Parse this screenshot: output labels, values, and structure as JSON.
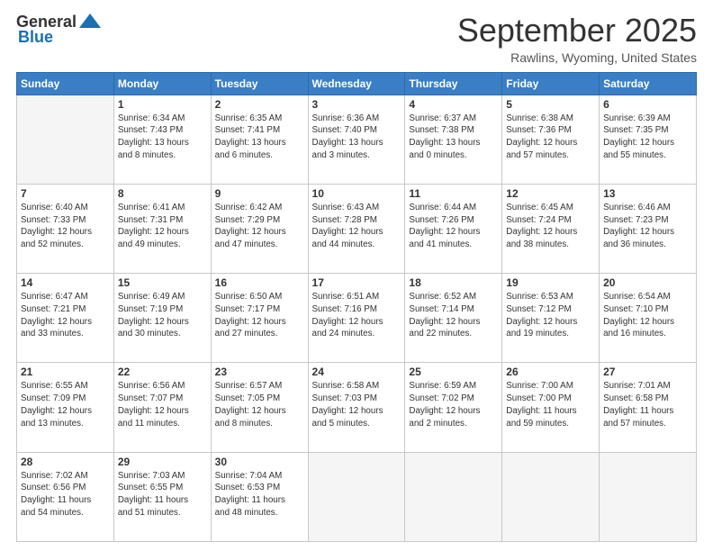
{
  "logo": {
    "general": "General",
    "blue": "Blue"
  },
  "header": {
    "month": "September 2025",
    "location": "Rawlins, Wyoming, United States"
  },
  "weekdays": [
    "Sunday",
    "Monday",
    "Tuesday",
    "Wednesday",
    "Thursday",
    "Friday",
    "Saturday"
  ],
  "weeks": [
    [
      {
        "day": "",
        "info": ""
      },
      {
        "day": "1",
        "info": "Sunrise: 6:34 AM\nSunset: 7:43 PM\nDaylight: 13 hours\nand 8 minutes."
      },
      {
        "day": "2",
        "info": "Sunrise: 6:35 AM\nSunset: 7:41 PM\nDaylight: 13 hours\nand 6 minutes."
      },
      {
        "day": "3",
        "info": "Sunrise: 6:36 AM\nSunset: 7:40 PM\nDaylight: 13 hours\nand 3 minutes."
      },
      {
        "day": "4",
        "info": "Sunrise: 6:37 AM\nSunset: 7:38 PM\nDaylight: 13 hours\nand 0 minutes."
      },
      {
        "day": "5",
        "info": "Sunrise: 6:38 AM\nSunset: 7:36 PM\nDaylight: 12 hours\nand 57 minutes."
      },
      {
        "day": "6",
        "info": "Sunrise: 6:39 AM\nSunset: 7:35 PM\nDaylight: 12 hours\nand 55 minutes."
      }
    ],
    [
      {
        "day": "7",
        "info": "Sunrise: 6:40 AM\nSunset: 7:33 PM\nDaylight: 12 hours\nand 52 minutes."
      },
      {
        "day": "8",
        "info": "Sunrise: 6:41 AM\nSunset: 7:31 PM\nDaylight: 12 hours\nand 49 minutes."
      },
      {
        "day": "9",
        "info": "Sunrise: 6:42 AM\nSunset: 7:29 PM\nDaylight: 12 hours\nand 47 minutes."
      },
      {
        "day": "10",
        "info": "Sunrise: 6:43 AM\nSunset: 7:28 PM\nDaylight: 12 hours\nand 44 minutes."
      },
      {
        "day": "11",
        "info": "Sunrise: 6:44 AM\nSunset: 7:26 PM\nDaylight: 12 hours\nand 41 minutes."
      },
      {
        "day": "12",
        "info": "Sunrise: 6:45 AM\nSunset: 7:24 PM\nDaylight: 12 hours\nand 38 minutes."
      },
      {
        "day": "13",
        "info": "Sunrise: 6:46 AM\nSunset: 7:23 PM\nDaylight: 12 hours\nand 36 minutes."
      }
    ],
    [
      {
        "day": "14",
        "info": "Sunrise: 6:47 AM\nSunset: 7:21 PM\nDaylight: 12 hours\nand 33 minutes."
      },
      {
        "day": "15",
        "info": "Sunrise: 6:49 AM\nSunset: 7:19 PM\nDaylight: 12 hours\nand 30 minutes."
      },
      {
        "day": "16",
        "info": "Sunrise: 6:50 AM\nSunset: 7:17 PM\nDaylight: 12 hours\nand 27 minutes."
      },
      {
        "day": "17",
        "info": "Sunrise: 6:51 AM\nSunset: 7:16 PM\nDaylight: 12 hours\nand 24 minutes."
      },
      {
        "day": "18",
        "info": "Sunrise: 6:52 AM\nSunset: 7:14 PM\nDaylight: 12 hours\nand 22 minutes."
      },
      {
        "day": "19",
        "info": "Sunrise: 6:53 AM\nSunset: 7:12 PM\nDaylight: 12 hours\nand 19 minutes."
      },
      {
        "day": "20",
        "info": "Sunrise: 6:54 AM\nSunset: 7:10 PM\nDaylight: 12 hours\nand 16 minutes."
      }
    ],
    [
      {
        "day": "21",
        "info": "Sunrise: 6:55 AM\nSunset: 7:09 PM\nDaylight: 12 hours\nand 13 minutes."
      },
      {
        "day": "22",
        "info": "Sunrise: 6:56 AM\nSunset: 7:07 PM\nDaylight: 12 hours\nand 11 minutes."
      },
      {
        "day": "23",
        "info": "Sunrise: 6:57 AM\nSunset: 7:05 PM\nDaylight: 12 hours\nand 8 minutes."
      },
      {
        "day": "24",
        "info": "Sunrise: 6:58 AM\nSunset: 7:03 PM\nDaylight: 12 hours\nand 5 minutes."
      },
      {
        "day": "25",
        "info": "Sunrise: 6:59 AM\nSunset: 7:02 PM\nDaylight: 12 hours\nand 2 minutes."
      },
      {
        "day": "26",
        "info": "Sunrise: 7:00 AM\nSunset: 7:00 PM\nDaylight: 11 hours\nand 59 minutes."
      },
      {
        "day": "27",
        "info": "Sunrise: 7:01 AM\nSunset: 6:58 PM\nDaylight: 11 hours\nand 57 minutes."
      }
    ],
    [
      {
        "day": "28",
        "info": "Sunrise: 7:02 AM\nSunset: 6:56 PM\nDaylight: 11 hours\nand 54 minutes."
      },
      {
        "day": "29",
        "info": "Sunrise: 7:03 AM\nSunset: 6:55 PM\nDaylight: 11 hours\nand 51 minutes."
      },
      {
        "day": "30",
        "info": "Sunrise: 7:04 AM\nSunset: 6:53 PM\nDaylight: 11 hours\nand 48 minutes."
      },
      {
        "day": "",
        "info": ""
      },
      {
        "day": "",
        "info": ""
      },
      {
        "day": "",
        "info": ""
      },
      {
        "day": "",
        "info": ""
      }
    ]
  ]
}
